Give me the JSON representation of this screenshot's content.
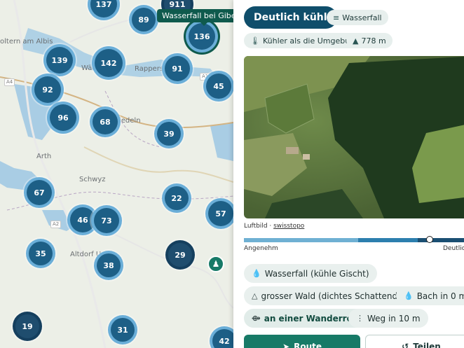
{
  "map": {
    "tooltip": "Wasserfall bei Gibel",
    "places": [
      "oltern am Albis",
      "Wäd",
      "Rappers",
      "iedeln",
      "Arth",
      "Schwyz",
      "Altdorf U"
    ],
    "road_tags": [
      "A4",
      "A1",
      "A2"
    ],
    "clusters": [
      "137",
      "89",
      "136",
      "139",
      "142",
      "91",
      "45",
      "92",
      "96",
      "68",
      "39",
      "67",
      "22",
      "57",
      "46",
      "73",
      "35",
      "29",
      "38",
      "19",
      "31",
      "42",
      "911"
    ]
  },
  "panel": {
    "title": "Deutlich kühl",
    "type_chip": "Wasserfall",
    "cooler_chip": "Kühler als die Umgebung",
    "elevation_chip": "778 m",
    "image_caption_label": "Luftbild · ",
    "image_caption_link": "swisstopo",
    "scale_left": "Angenehm",
    "scale_right": "Deutlic",
    "scale_position_fraction": 0.86,
    "features": [
      "Wasserfall (kühle Gischt)",
      "grosser Wald (dichtes Schattendach)",
      "Bach in 0 m",
      "an einer Wanderroute",
      "Weg in 10 m"
    ],
    "route_button": "Route",
    "share_button": "Teilen"
  },
  "colors": {
    "cluster_dark": "#1d5f86",
    "cluster_light": "#3f92c5",
    "accent_green": "#177a67",
    "title_bg": "#0f4e6b"
  }
}
